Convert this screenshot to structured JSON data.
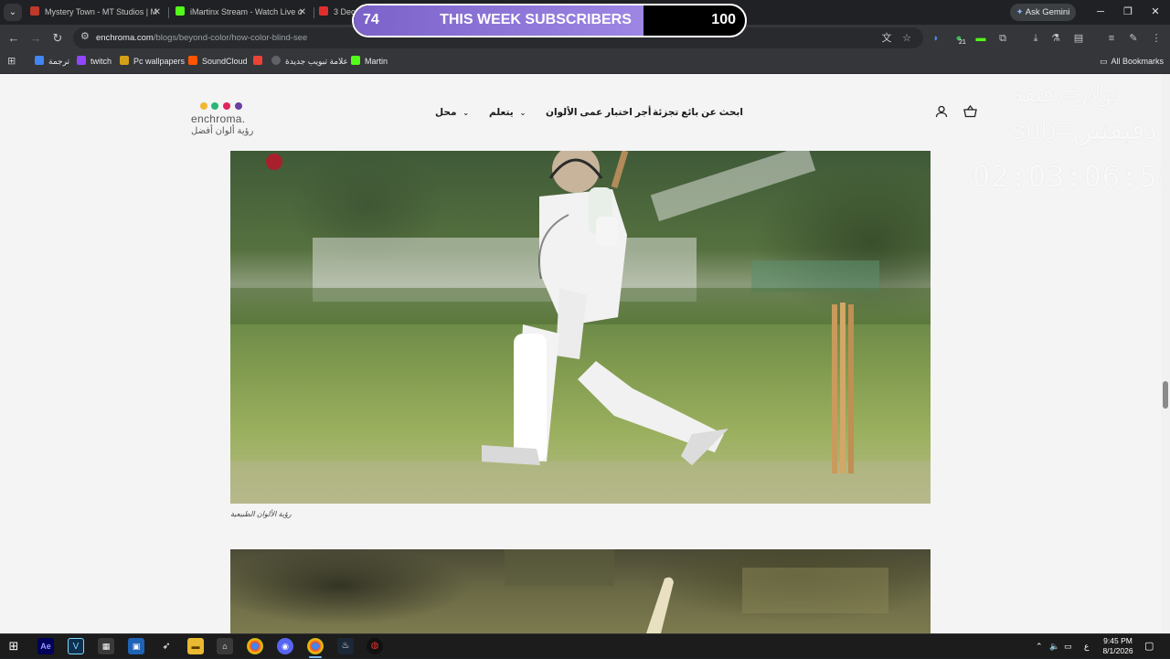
{
  "browser": {
    "tabs": [
      {
        "title": "Mystery Town - MT Studios | M",
        "favicon_color": "#c0392b"
      },
      {
        "title": "iMartinx Stream - Watch Live o",
        "favicon_color": "#53fc18"
      },
      {
        "title": "3 Dec",
        "favicon_color": "#e02e2e"
      }
    ],
    "ask_gemini": "Ask Gemini",
    "url_host": "enchroma.com",
    "url_path": "/blogs/beyond-color/how-color-blind-see",
    "bookmarks": [
      {
        "label": "ترجمة",
        "color": "#4285f4"
      },
      {
        "label": "twitch",
        "color": "#9146ff"
      },
      {
        "label": "Pc wallpapers",
        "color": "#d4a017"
      },
      {
        "label": "SoundCloud",
        "color": "#ff5500"
      },
      {
        "label": "",
        "color": "#ea4335"
      },
      {
        "label": "علامة تبويب جديدة",
        "color": "#5f6368"
      },
      {
        "label": "Martin",
        "color": "#53fc18"
      }
    ],
    "all_bookmarks": "All Bookmarks",
    "extension_badge": "21"
  },
  "overlay": {
    "subscribers_current": "74",
    "subscribers_title": "THIS WEEK SUBSCRIBERS",
    "subscribers_goal": "100",
    "progress_fraction": 0.74,
    "rule_1": "دولار=دقيقه",
    "rule_2": "sub=دقيقتين",
    "timer": "02:03:06:58"
  },
  "site": {
    "logo_text": "enchroma.",
    "logo_tagline": "رؤية ألوان أفضل",
    "logo_dot_colors": [
      "#f2b632",
      "#2bb673",
      "#e0245e",
      "#6c3fa0"
    ],
    "nav": {
      "shop": "محل",
      "learn": "يتعلم",
      "test": "أجر اختبار عمى الألوان",
      "find_retailer": "ابحث عن بائع تجزئة"
    },
    "photo_caption": "رؤية الألوان الطبيعية"
  },
  "taskbar": {
    "time": "9:45 PM",
    "date": "8/1/2026",
    "input_lang": "ع"
  }
}
